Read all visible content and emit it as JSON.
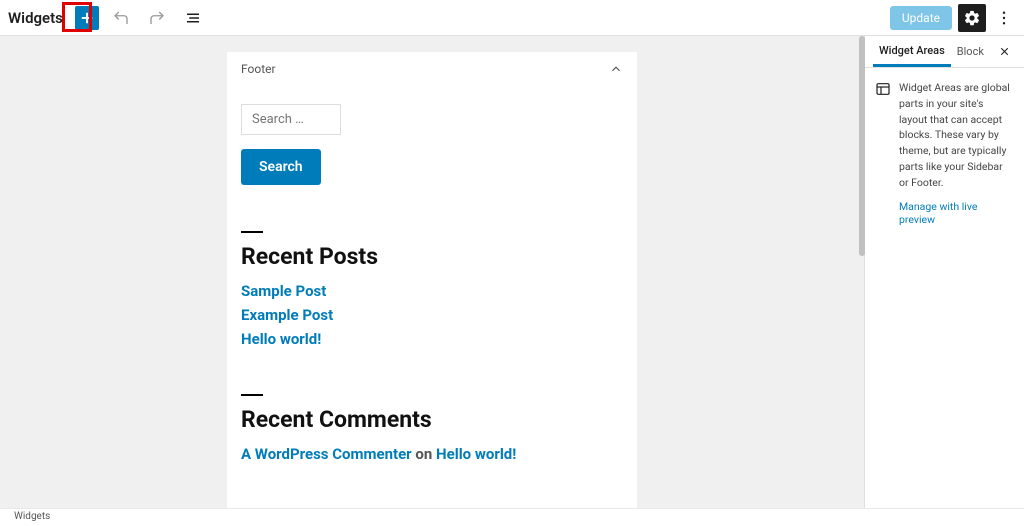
{
  "toolbar": {
    "title": "Widgets",
    "update_label": "Update"
  },
  "panel": {
    "title": "Footer",
    "search_placeholder": "Search …",
    "search_button": "Search",
    "recent_posts_heading": "Recent Posts",
    "posts": [
      "Sample Post",
      "Example Post",
      "Hello world!"
    ],
    "recent_comments_heading": "Recent Comments",
    "comment_author": "A WordPress Commenter",
    "comment_on": "on",
    "comment_post": "Hello world!"
  },
  "sidebar": {
    "tab_widget_areas": "Widget Areas",
    "tab_block": "Block",
    "description": "Widget Areas are global parts in your site's layout that can accept blocks. These vary by theme, but are typically parts like your Sidebar or Footer.",
    "manage_link": "Manage with live preview"
  },
  "footer": {
    "breadcrumb": "Widgets"
  }
}
